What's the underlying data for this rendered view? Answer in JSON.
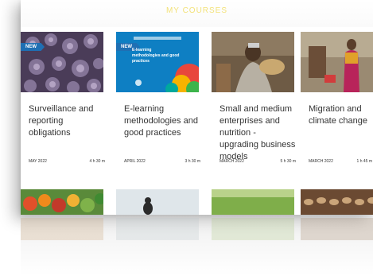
{
  "header": {
    "title": "MY COURSES"
  },
  "cards": [
    {
      "title": "Surveillance and reporting obligations",
      "date": "MAY 2022",
      "duration": "4 h 30 m",
      "badge": "NEW",
      "thumb_color": "#5b4a6a"
    },
    {
      "title": "E-learning methodologies and good practices",
      "date": "APRIL 2022",
      "duration": "3 h 30 m",
      "badge": "NEW",
      "thumb_color": "#0e7fc3",
      "thumb_text": "E-learning methodologies and good practices"
    },
    {
      "title": "Small and medium enterprises and nutrition - upgrading business models",
      "date": "MARCH 2022",
      "duration": "5 h 30 m",
      "badge": "",
      "thumb_color": "#6b5a45"
    },
    {
      "title": "Migration and climate change",
      "date": "MARCH 2022",
      "duration": "1 h 45 m",
      "badge": "",
      "thumb_color": "#8a7a68"
    }
  ]
}
